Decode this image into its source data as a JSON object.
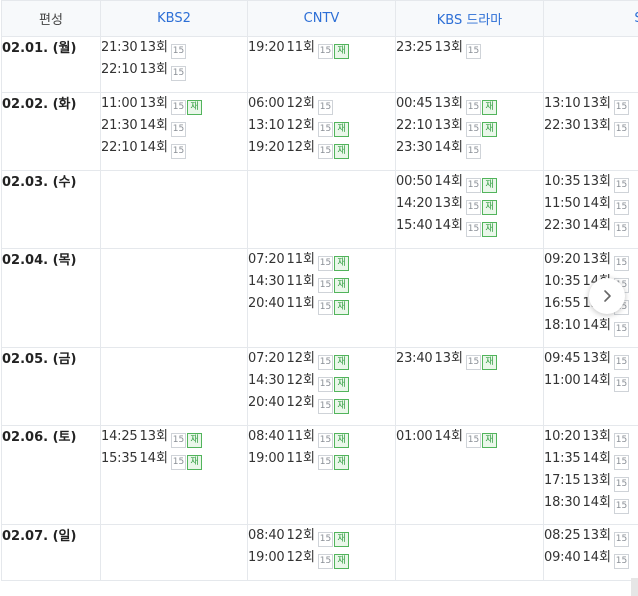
{
  "header": {
    "corner_label": "편성",
    "channels": [
      "KBS2",
      "CNTV",
      "KBS 드라마",
      "SKY"
    ]
  },
  "badges": {
    "rating": "15",
    "rerun": "재"
  },
  "rows": [
    {
      "date": "02.01. (월)",
      "cells": [
        [
          {
            "time": "21:30",
            "ep": "13회",
            "rerun": false
          },
          {
            "time": "22:10",
            "ep": "13회",
            "rerun": false
          }
        ],
        [
          {
            "time": "19:20",
            "ep": "11회",
            "rerun": true
          }
        ],
        [
          {
            "time": "23:25",
            "ep": "13회",
            "rerun": false
          }
        ],
        []
      ]
    },
    {
      "date": "02.02. (화)",
      "cells": [
        [
          {
            "time": "11:00",
            "ep": "13회",
            "rerun": true
          },
          {
            "time": "21:30",
            "ep": "14회",
            "rerun": false
          },
          {
            "time": "22:10",
            "ep": "14회",
            "rerun": false
          }
        ],
        [
          {
            "time": "06:00",
            "ep": "12회",
            "rerun": false
          },
          {
            "time": "13:10",
            "ep": "12회",
            "rerun": true
          },
          {
            "time": "19:20",
            "ep": "12회",
            "rerun": true
          }
        ],
        [
          {
            "time": "00:45",
            "ep": "13회",
            "rerun": true
          },
          {
            "time": "22:10",
            "ep": "13회",
            "rerun": true
          },
          {
            "time": "23:30",
            "ep": "14회",
            "rerun": false
          }
        ],
        [
          {
            "time": "13:10",
            "ep": "13회",
            "rerun": false
          },
          {
            "time": "22:30",
            "ep": "13회",
            "rerun": false
          }
        ]
      ]
    },
    {
      "date": "02.03. (수)",
      "cells": [
        [],
        [],
        [
          {
            "time": "00:50",
            "ep": "14회",
            "rerun": true
          },
          {
            "time": "14:20",
            "ep": "13회",
            "rerun": true
          },
          {
            "time": "15:40",
            "ep": "14회",
            "rerun": true
          }
        ],
        [
          {
            "time": "10:35",
            "ep": "13회",
            "rerun": false
          },
          {
            "time": "11:50",
            "ep": "14회",
            "rerun": false
          },
          {
            "time": "22:30",
            "ep": "14회",
            "rerun": false
          }
        ]
      ]
    },
    {
      "date": "02.04. (목)",
      "cells": [
        [],
        [
          {
            "time": "07:20",
            "ep": "11회",
            "rerun": true
          },
          {
            "time": "14:30",
            "ep": "11회",
            "rerun": true
          },
          {
            "time": "20:40",
            "ep": "11회",
            "rerun": true
          }
        ],
        [],
        [
          {
            "time": "09:20",
            "ep": "13회",
            "rerun": false
          },
          {
            "time": "10:35",
            "ep": "14회",
            "rerun": false
          },
          {
            "time": "16:55",
            "ep": "13회",
            "rerun": false
          },
          {
            "time": "18:10",
            "ep": "14회",
            "rerun": false
          }
        ]
      ]
    },
    {
      "date": "02.05. (금)",
      "cells": [
        [],
        [
          {
            "time": "07:20",
            "ep": "12회",
            "rerun": true
          },
          {
            "time": "14:30",
            "ep": "12회",
            "rerun": true
          },
          {
            "time": "20:40",
            "ep": "12회",
            "rerun": true
          }
        ],
        [
          {
            "time": "23:40",
            "ep": "13회",
            "rerun": true
          }
        ],
        [
          {
            "time": "09:45",
            "ep": "13회",
            "rerun": false
          },
          {
            "time": "11:00",
            "ep": "14회",
            "rerun": false
          }
        ]
      ]
    },
    {
      "date": "02.06. (토)",
      "cells": [
        [
          {
            "time": "14:25",
            "ep": "13회",
            "rerun": true
          },
          {
            "time": "15:35",
            "ep": "14회",
            "rerun": true
          }
        ],
        [
          {
            "time": "08:40",
            "ep": "11회",
            "rerun": true
          },
          {
            "time": "19:00",
            "ep": "11회",
            "rerun": true
          }
        ],
        [
          {
            "time": "01:00",
            "ep": "14회",
            "rerun": true
          }
        ],
        [
          {
            "time": "10:20",
            "ep": "13회",
            "rerun": false
          },
          {
            "time": "11:35",
            "ep": "14회",
            "rerun": false
          },
          {
            "time": "17:15",
            "ep": "13회",
            "rerun": false
          },
          {
            "time": "18:30",
            "ep": "14회",
            "rerun": false
          }
        ]
      ]
    },
    {
      "date": "02.07. (일)",
      "cells": [
        [],
        [
          {
            "time": "08:40",
            "ep": "12회",
            "rerun": true
          },
          {
            "time": "19:00",
            "ep": "12회",
            "rerun": true
          }
        ],
        [],
        [
          {
            "time": "08:25",
            "ep": "13회",
            "rerun": false
          },
          {
            "time": "09:40",
            "ep": "14회",
            "rerun": false
          }
        ]
      ]
    }
  ],
  "controls": {
    "next_icon": "chevron-right-icon"
  },
  "colors": {
    "channel_link": "#2d6fd6",
    "rerun_green": "#2f9e3f",
    "border": "#e5e8ec"
  }
}
